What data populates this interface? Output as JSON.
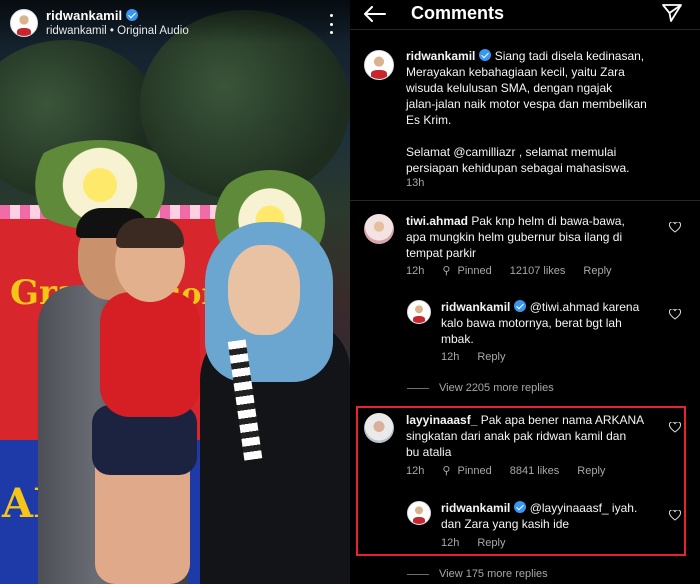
{
  "video": {
    "username": "ridwankamil",
    "audio": "ridwankamil • Original Audio",
    "banner_lines": [
      "Gra",
      "ion",
      "ARI"
    ]
  },
  "header": {
    "title": "Comments"
  },
  "caption": {
    "username": "ridwankamil",
    "lines": [
      "Siang tadi disela kedinasan,",
      "Merayakan kebahagiaan kecil, yaitu Zara",
      "wisuda kelulusan SMA, dengan ngajak",
      "jalan-jalan naik motor vespa dan membelikan",
      "Es Krim.",
      "",
      "Selamat @camilliazr , selamat memulai",
      "persiapan kehidupan sebagai mahasiswa."
    ],
    "time": "13h"
  },
  "comments": [
    {
      "username": "tiwi.ahmad",
      "lines": [
        "Pak knp helm di bawa-bawa,",
        "apa mungkin helm gubernur bisa ilang di",
        "tempat parkir"
      ],
      "time": "12h",
      "pinned": "Pinned",
      "likes": "12107 likes",
      "reply": "Reply",
      "replies": [
        {
          "username": "ridwankamil",
          "lines": [
            "@tiwi.ahmad karena",
            "kalo bawa motornya, berat bgt lah",
            "mbak."
          ],
          "time": "12h",
          "reply": "Reply"
        }
      ],
      "view_more": "View 2205 more replies"
    },
    {
      "username": "layyinaaasf_",
      "lines": [
        "Pak apa bener nama ARKANA",
        "singkatan dari anak pak ridwan kamil dan",
        "bu atalia"
      ],
      "time": "12h",
      "pinned": "Pinned",
      "likes": "8841 likes",
      "reply": "Reply",
      "replies": [
        {
          "username": "ridwankamil",
          "lines": [
            "@layyinaaasf_ iyah.",
            "dan Zara yang kasih ide"
          ],
          "time": "12h",
          "reply": "Reply"
        }
      ],
      "view_more": "View 175 more replies"
    }
  ],
  "colors": {
    "accent": "#3897f0",
    "highlight": "#e8232e",
    "muted": "#a8a8a8"
  }
}
